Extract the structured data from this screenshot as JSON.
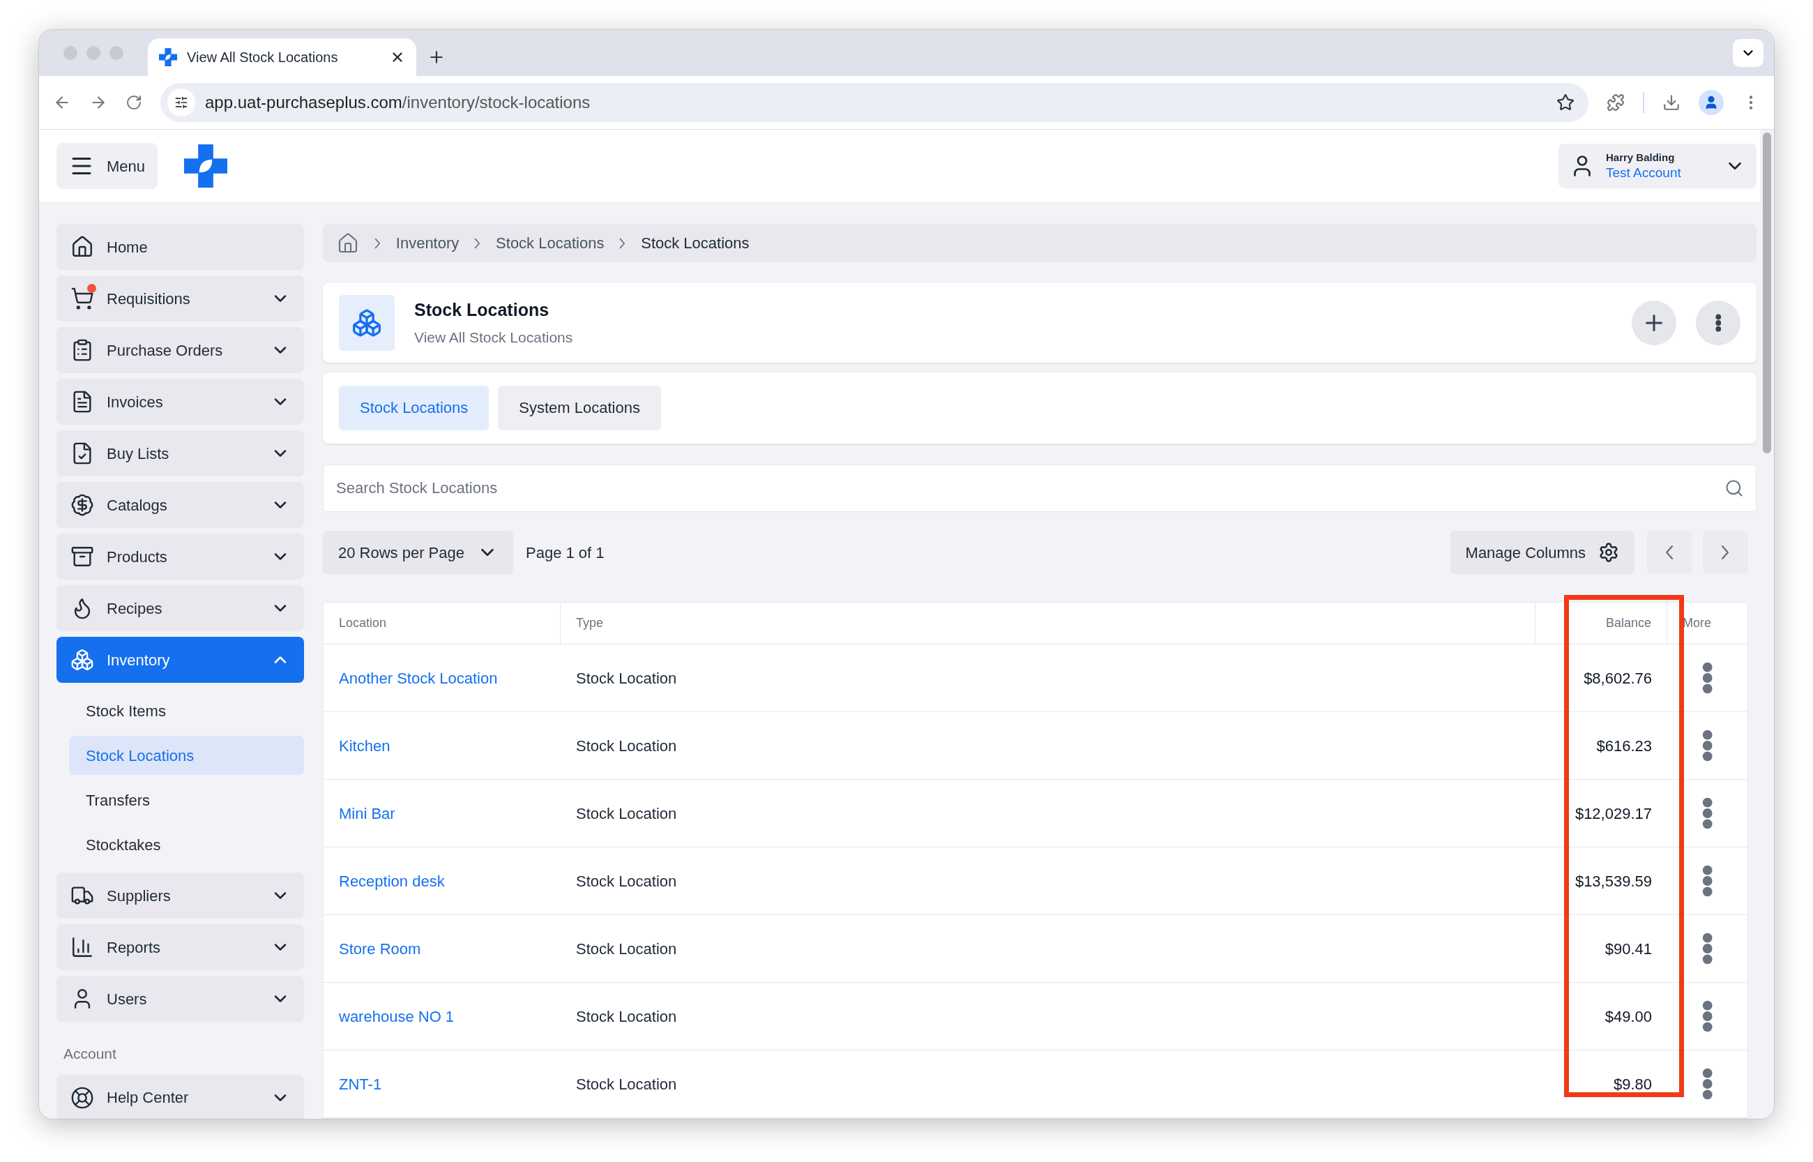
{
  "browser": {
    "tab_title": "View All Stock Locations",
    "url": {
      "host": "app.uat-purchaseplus.com",
      "path": "/inventory/stock-locations"
    }
  },
  "header": {
    "menu_label": "Menu",
    "user": {
      "name": "Harry Balding",
      "account": "Test Account"
    }
  },
  "sidebar": {
    "items": [
      {
        "kind": "item",
        "label": "Home",
        "notification": false
      },
      {
        "kind": "group",
        "label": "Requisitions",
        "expanded": false,
        "selected": false,
        "notification": true
      },
      {
        "kind": "group",
        "label": "Purchase Orders",
        "expanded": false,
        "selected": false,
        "notification": false
      },
      {
        "kind": "group",
        "label": "Invoices",
        "expanded": false,
        "selected": false,
        "notification": false
      },
      {
        "kind": "group",
        "label": "Buy Lists",
        "expanded": false,
        "selected": false,
        "notification": false
      },
      {
        "kind": "group",
        "label": "Catalogs",
        "expanded": false,
        "selected": false,
        "notification": false
      },
      {
        "kind": "group",
        "label": "Products",
        "expanded": false,
        "selected": false,
        "notification": false
      },
      {
        "kind": "group",
        "label": "Recipes",
        "expanded": false,
        "selected": false,
        "notification": false
      },
      {
        "kind": "group",
        "label": "Inventory",
        "expanded": true,
        "selected": true,
        "notification": false,
        "children": [
          {
            "label": "Stock Items",
            "selected": false
          },
          {
            "label": "Stock Locations",
            "selected": true
          },
          {
            "label": "Transfers",
            "selected": false
          },
          {
            "label": "Stocktakes",
            "selected": false
          }
        ]
      },
      {
        "kind": "group",
        "label": "Suppliers",
        "expanded": false,
        "selected": false,
        "notification": false
      },
      {
        "kind": "group",
        "label": "Reports",
        "expanded": false,
        "selected": false,
        "notification": false
      },
      {
        "kind": "group",
        "label": "Users",
        "expanded": false,
        "selected": false,
        "notification": false
      },
      {
        "kind": "section",
        "label": "Account"
      },
      {
        "kind": "group",
        "label": "Help Center",
        "expanded": false,
        "selected": false,
        "notification": false
      }
    ]
  },
  "breadcrumb": [
    "Inventory",
    "Stock Locations",
    "Stock Locations"
  ],
  "page_header": {
    "title": "Stock Locations",
    "subtitle": "View All Stock Locations"
  },
  "tabs": [
    {
      "label": "Stock Locations",
      "selected": true
    },
    {
      "label": "System Locations",
      "selected": false
    }
  ],
  "search": {
    "placeholder": "Search Stock Locations"
  },
  "toolbar": {
    "rows_per_page": "20 Rows per Page",
    "page_info": "Page 1 of 1",
    "manage_columns": "Manage Columns"
  },
  "table": {
    "columns": [
      {
        "label": "Location",
        "highlighted": false
      },
      {
        "label": "Type",
        "highlighted": false
      },
      {
        "label": "Balance",
        "highlighted": true
      },
      {
        "label": "More",
        "highlighted": false
      }
    ],
    "rows": [
      {
        "location": "Another Stock Location",
        "type": "Stock Location",
        "balance": "$8,602.76"
      },
      {
        "location": "Kitchen",
        "type": "Stock Location",
        "balance": "$616.23"
      },
      {
        "location": "Mini Bar",
        "type": "Stock Location",
        "balance": "$12,029.17"
      },
      {
        "location": "Reception desk",
        "type": "Stock Location",
        "balance": "$13,539.59"
      },
      {
        "location": "Store Room",
        "type": "Stock Location",
        "balance": "$90.41"
      },
      {
        "location": "warehouse NO 1",
        "type": "Stock Location",
        "balance": "$49.00"
      },
      {
        "location": "ZNT-1",
        "type": "Stock Location",
        "balance": "$9.80"
      }
    ]
  }
}
